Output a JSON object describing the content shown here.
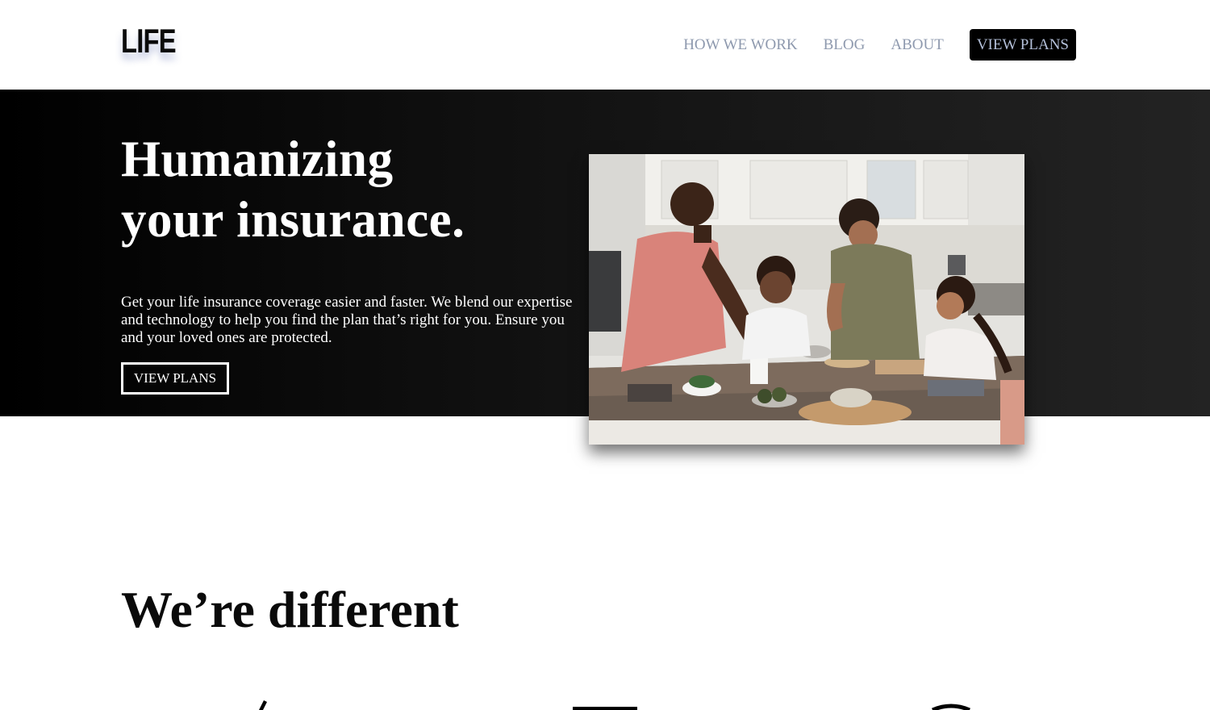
{
  "header": {
    "logo": "LIFE",
    "nav": [
      {
        "label": "HOW WE WORK"
      },
      {
        "label": "BLOG"
      },
      {
        "label": "ABOUT"
      }
    ],
    "cta_label": "VIEW PLANS"
  },
  "hero": {
    "title_line1": "Humanizing",
    "title_line2": "your insurance.",
    "description": "Get your life insurance coverage easier and faster. We blend our expertise and technology to help you find the plan that’s right for you. Ensure you and your loved ones are protected.",
    "button_label": "VIEW PLANS"
  },
  "section": {
    "title": "We’re different"
  },
  "icons": [
    "feature-icon-1",
    "feature-icon-2",
    "feature-icon-3"
  ]
}
